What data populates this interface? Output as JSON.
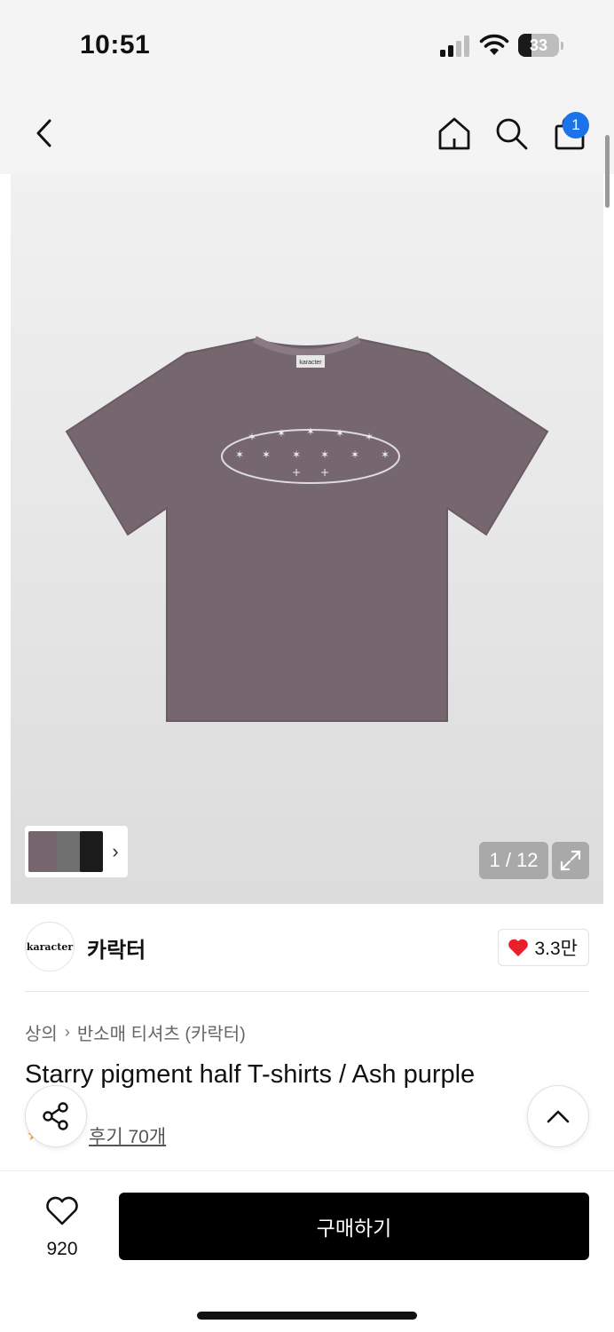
{
  "status_bar": {
    "time": "10:51",
    "battery": "33",
    "battery_level": 0.33
  },
  "nav": {
    "cart_count": "1"
  },
  "gallery": {
    "page_indicator": "1 / 12",
    "next_glyph": "›",
    "shirt_tag": "karacter"
  },
  "brand": {
    "logo_text": "karacter",
    "name": "카락터",
    "likes": "3.3만"
  },
  "breadcrumb": [
    "상의",
    "반소매 티셔츠 (카락터)"
  ],
  "product": {
    "title": "Starry pigment half T-shirts / Ash purple",
    "reviews": "후기 70개"
  },
  "bottom": {
    "wish_count": "920",
    "buy_label": "구매하기"
  },
  "colors": {
    "accent_badge": "#1a73e8",
    "shirt": "#76676f",
    "heart": "#e8202a",
    "buy_button": "#000000"
  }
}
